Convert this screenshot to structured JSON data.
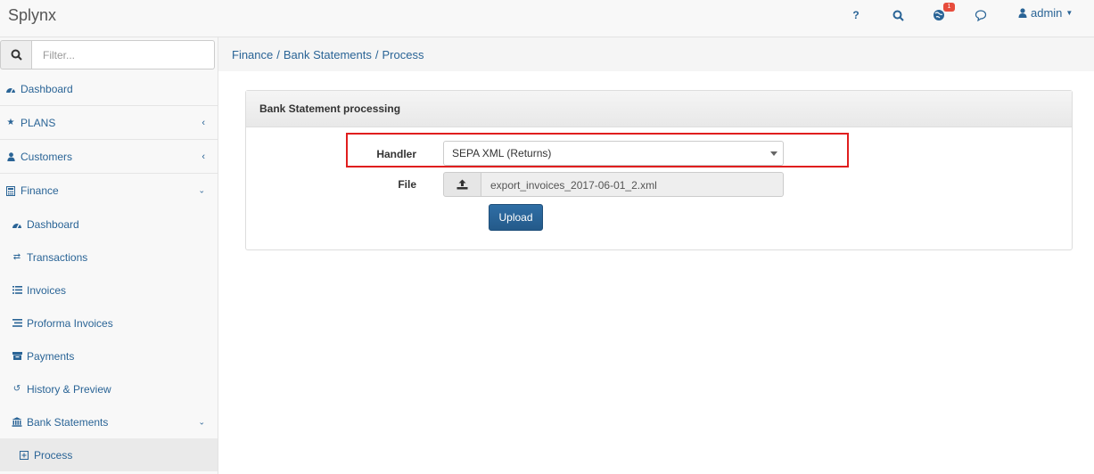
{
  "app": {
    "brand": "Splynx"
  },
  "topbar": {
    "help_label": "?",
    "notification_count": "1",
    "user_label": "admin",
    "icons": [
      "help-icon",
      "search-icon",
      "globe-icon",
      "chat-icon",
      "user-icon"
    ]
  },
  "sidebar": {
    "filter_placeholder": "Filter...",
    "items": [
      {
        "label": "Dashboard",
        "icon": "dashboard-icon"
      },
      {
        "label": "PLANS",
        "icon": "star-icon"
      },
      {
        "label": "Customers",
        "icon": "user-icon"
      },
      {
        "label": "Finance",
        "icon": "calculator-icon"
      }
    ],
    "finance_items": [
      {
        "label": "Dashboard",
        "icon": "dashboard-icon"
      },
      {
        "label": "Transactions",
        "icon": "exchange-icon"
      },
      {
        "label": "Invoices",
        "icon": "list-icon"
      },
      {
        "label": "Proforma Invoices",
        "icon": "list-alt-icon"
      },
      {
        "label": "Payments",
        "icon": "payments-icon"
      },
      {
        "label": "History & Preview",
        "icon": "history-icon"
      },
      {
        "label": "Bank Statements",
        "icon": "bank-icon"
      }
    ],
    "bank_items": [
      {
        "label": "Process",
        "icon": "plus-square-icon"
      }
    ]
  },
  "breadcrumb": [
    "Finance",
    "Bank Statements",
    "Process"
  ],
  "panel": {
    "title": "Bank Statement processing",
    "handler_label": "Handler",
    "handler_value": "SEPA XML (Returns)",
    "file_label": "File",
    "file_name": "export_invoices_2017-06-01_2.xml",
    "upload_label": "Upload"
  },
  "colors": {
    "link": "#2a6496",
    "highlight": "#e01e1e",
    "upload_button": "#2a6496",
    "badge": "#e74c3c"
  }
}
